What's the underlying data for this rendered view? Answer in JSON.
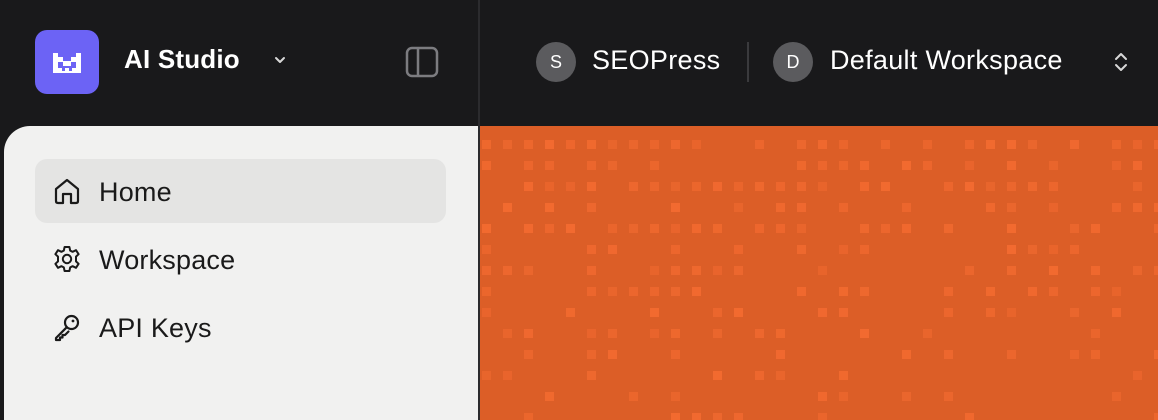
{
  "header": {
    "app_name": "AI Studio",
    "organization": {
      "initial": "S",
      "name": "SEOPress"
    },
    "workspace": {
      "initial": "D",
      "name": "Default Workspace"
    }
  },
  "sidebar": {
    "items": [
      {
        "label": "Home",
        "icon": "home-icon",
        "active": true
      },
      {
        "label": "Workspace",
        "icon": "gear-icon",
        "active": false
      },
      {
        "label": "API Keys",
        "icon": "key-icon",
        "active": false
      }
    ]
  },
  "colors": {
    "brand": "#6c63f5",
    "header_bg": "#19191b",
    "sidebar_bg": "#f1f1f0",
    "active_item_bg": "#e4e4e3",
    "banner_orange": "#dc5e27",
    "pattern_square": "#f26a30"
  }
}
